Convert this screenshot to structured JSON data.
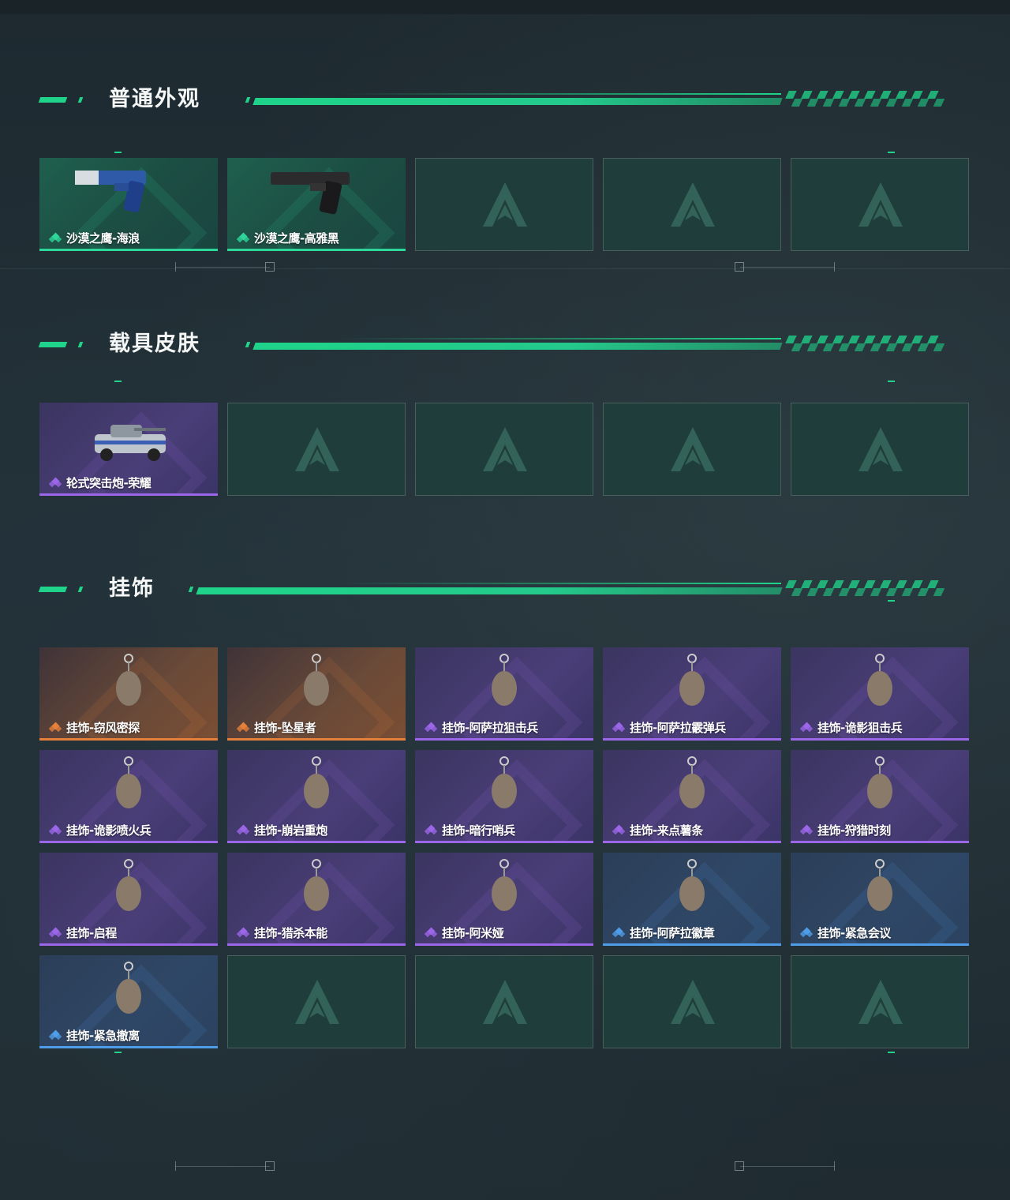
{
  "sections": [
    {
      "title": "普通外观",
      "items": [
        {
          "label": "沙漠之鹰-海浪",
          "rarity": "green",
          "icon": "desert-eagle-blue-pistol"
        },
        {
          "label": "沙漠之鹰-高雅黑",
          "rarity": "green",
          "icon": "desert-eagle-black-pistol"
        },
        {
          "empty": true
        },
        {
          "empty": true
        },
        {
          "empty": true
        }
      ]
    },
    {
      "title": "载具皮肤",
      "items": [
        {
          "label": "轮式突击炮-荣耀",
          "rarity": "purple",
          "icon": "armored-vehicle"
        },
        {
          "empty": true
        },
        {
          "empty": true
        },
        {
          "empty": true
        },
        {
          "empty": true
        }
      ]
    },
    {
      "title": "挂饰",
      "items": [
        {
          "label": "挂饰-窃风密探",
          "rarity": "orange",
          "icon": "rabbit-charm"
        },
        {
          "label": "挂饰-坠星者",
          "rarity": "orange",
          "icon": "purple-crystal-charm"
        },
        {
          "label": "挂饰-阿萨拉狙击兵",
          "rarity": "purple",
          "icon": "soldier-charm"
        },
        {
          "label": "挂饰-阿萨拉霰弹兵",
          "rarity": "purple",
          "icon": "soldier-charm"
        },
        {
          "label": "挂饰-诡影狙击兵",
          "rarity": "purple",
          "icon": "masked-soldier-charm"
        },
        {
          "label": "挂饰-诡影喷火兵",
          "rarity": "purple",
          "icon": "flamethrower-charm"
        },
        {
          "label": "挂饰-崩岩重炮",
          "rarity": "purple",
          "icon": "heavy-gunner-charm"
        },
        {
          "label": "挂饰-暗行哨兵",
          "rarity": "purple",
          "icon": "sentinel-charm"
        },
        {
          "label": "挂饰-来点薯条",
          "rarity": "purple",
          "icon": "fries-charm"
        },
        {
          "label": "挂饰-狩猎时刻",
          "rarity": "purple",
          "icon": "moose-antler-charm"
        },
        {
          "label": "挂饰-启程",
          "rarity": "purple",
          "icon": "medallion-charm"
        },
        {
          "label": "挂饰-猎杀本能",
          "rarity": "purple",
          "icon": "moose-antler-charm"
        },
        {
          "label": "挂饰-阿米娅",
          "rarity": "purple",
          "icon": "bunny-charm"
        },
        {
          "label": "挂饰-阿萨拉徽章",
          "rarity": "blue",
          "icon": "badge-charm"
        },
        {
          "label": "挂饰-紧急会议",
          "rarity": "blue",
          "icon": "cartoon-charm"
        },
        {
          "label": "挂饰-紧急撤离",
          "rarity": "blue",
          "icon": "green-box-charm"
        },
        {
          "empty": true
        },
        {
          "empty": true
        },
        {
          "empty": true
        },
        {
          "empty": true
        }
      ]
    }
  ],
  "colors": {
    "accent": "#1fd48a",
    "green": "#2ed69a",
    "purple": "#9b67e8",
    "orange": "#e4803a",
    "blue": "#4f9de8"
  }
}
